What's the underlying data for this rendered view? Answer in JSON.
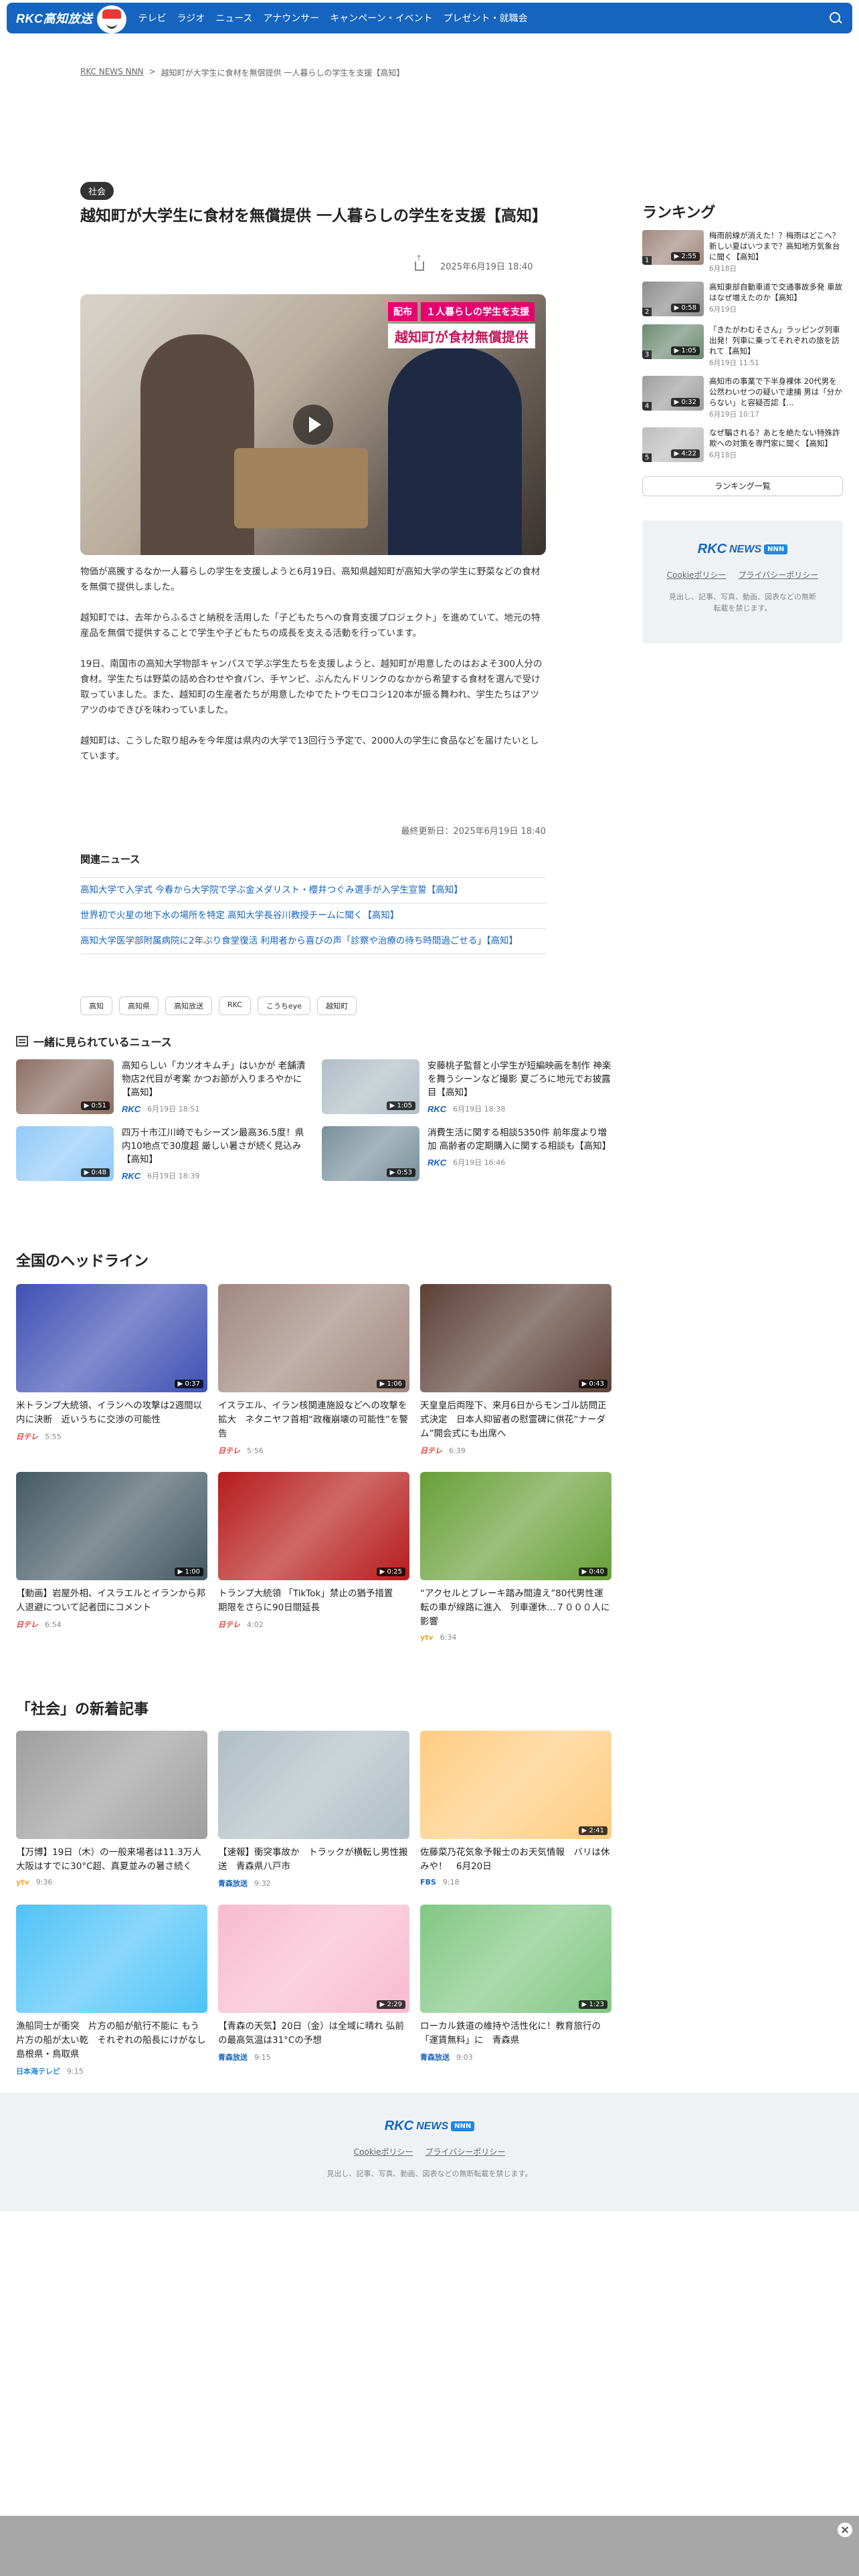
{
  "header": {
    "logo": "RKC高知放送",
    "nav": [
      "テレビ",
      "ラジオ",
      "ニュース",
      "アナウンサー",
      "キャンペーン・イベント",
      "プレゼント・就職会"
    ]
  },
  "breadcrumb": {
    "home": "RKC NEWS NNN",
    "separator": ">",
    "current": "越知町が大学生に食材を無償提供 一人暮らしの学生を支援【高知】"
  },
  "article": {
    "category": "社会",
    "title": "越知町が大学生に食材を無償提供 一人暮らしの学生を支援【高知】",
    "date": "2025年6月19日 18:40",
    "caption_tag": "配布",
    "caption_line1": "１人暮らしの学生を支援",
    "caption_line2": "越知町が食材無償提供",
    "paragraphs": [
      "物価が高騰するなか一人暮らしの学生を支援しようと6月19日、高知県越知町が高知大学の学生に野菜などの食材を無償で提供しました。",
      "越知町では、去年からふるさと納税を活用した「子どもたちへの食育支援プロジェクト」を進めていて、地元の特産品を無償で提供することで学生や子どもたちの成長を支える活動を行っています。",
      "19日、南国市の高知大学物部キャンパスで学ぶ学生たちを支援しようと、越知町が用意したのはおよそ300人分の食材。学生たちは野菜の詰め合わせや食パン、手ヤンピ、ぶんたんドリンクのなかから希望する食材を選んで受け取っていました。また、越知町の生産者たちが用意したゆでたトウモロコシ120本が振る舞われ、学生たちはアツアツのゆできびを味わっていました。",
      "越知町は、こうした取り組みを今年度は県内の大学で13回行う予定で、2000人の学生に食品などを届けたいとしています。"
    ],
    "updated": "最終更新日：2025年6月19日 18:40"
  },
  "related": {
    "heading": "関連ニュース",
    "items": [
      "高知大学で入学式 今春から大学院で学ぶ金メダリスト・櫻井つぐみ選手が入学生宣誓【高知】",
      "世界初で火星の地下水の場所を特定 高知大学長谷川教授チームに聞く【高知】",
      "高知大学医学部附属病院に2年ぶり食堂復活 利用者から喜びの声「診察や治療の待ち時間過ごせる」【高知】"
    ]
  },
  "tags": [
    "高知",
    "高知県",
    "高知放送",
    "RKC",
    "こうちeye",
    "越知町"
  ],
  "also_read": {
    "heading": "一緒に見られているニュース",
    "items": [
      {
        "title": "高知らしい「カツオキムチ」はいかが 老舗漬物店2代目が考案 かつお節が入りまろやかに【高知】",
        "source": "RKC",
        "date": "6月19日 18:51",
        "duration": "0:51",
        "color": "#8d6e63"
      },
      {
        "title": "安藤桃子監督と小学生が短編映画を制作 神楽を舞うシーンなど撮影 夏ごろに地元でお披露目【高知】",
        "source": "RKC",
        "date": "6月19日 18:38",
        "duration": "1:05",
        "color": "#b0bec5"
      },
      {
        "title": "四万十市江川崎でもシーズン最高36.5度！県内10地点で30度超 厳しい暑さが続く見込み【高知】",
        "source": "RKC",
        "date": "6月19日 18:39",
        "duration": "0:48",
        "color": "#90caf9"
      },
      {
        "title": "消費生活に関する相談5350件 前年度より増加 高齢者の定期購入に関する相談も【高知】",
        "source": "RKC",
        "date": "6月19日 16:46",
        "duration": "0:53",
        "color": "#78909c"
      }
    ]
  },
  "ranking": {
    "heading": "ランキング",
    "more": "ランキング一覧",
    "items": [
      {
        "num": "1",
        "title": "梅雨前線が消えた！？梅雨はどこへ？新しい夏はいつまで？高知地方気象台に聞く【高知】",
        "date": "6月18日",
        "duration": "2:55",
        "color": "#a1887f"
      },
      {
        "title": "高知東部自動車道で交通事故多発 車故はなぜ増えたのか【高知】",
        "num": "2",
        "date": "6月19日",
        "duration": "0:58",
        "color": "#8d8d8d"
      },
      {
        "num": "3",
        "title": "「きたがわむそさん」ラッピング列車出発！列車に乗ってそれぞれの旅を訪れて【高知】",
        "date": "6月19日 11:51",
        "duration": "1:05",
        "color": "#6d8b74"
      },
      {
        "num": "4",
        "title": "高知市の事業で下半身裸体 20代男を公然わいせつの疑いで逮捕 男は「分からない」と容疑否認【…",
        "date": "6月19日 10:17",
        "duration": "0:32",
        "color": "#9e9e9e"
      },
      {
        "num": "5",
        "title": "なぜ騙される？あとを絶たない特殊詐欺への対策を専門家に聞く【高知】",
        "date": "6月18日",
        "duration": "4:22",
        "color": "#bdbdbd"
      }
    ]
  },
  "footer": {
    "brand_rkc": "RKC",
    "brand_news": "NEWS",
    "brand_nnn": "NNN",
    "cookie": "Cookieポリシー",
    "privacy": "プライバシーポリシー",
    "note": "見出し、記事、写真、動画、図表などの無断転載を禁じます。"
  },
  "national": {
    "heading": "全国のヘッドライン",
    "items": [
      {
        "title": "米トランプ大統領、イランへの攻撃は2週間以内に決断　近いうちに交渉の可能性",
        "source": "日テレ",
        "src_class": "ntv",
        "time": "5:55",
        "duration": "0:37",
        "color": "#3f51b5"
      },
      {
        "title": "イスラエル、イラン核関連施設などへの攻撃を拡大　ネタニヤフ首相“政権崩壊の可能性”を警告",
        "source": "日テレ",
        "src_class": "ntv",
        "time": "5:56",
        "duration": "1:06",
        "color": "#a1887f"
      },
      {
        "title": "天皇皇后両陛下、来月6日からモンゴル訪問正式決定　日本人抑留者の慰霊碑に供花“ナーダム”開会式にも出席へ",
        "source": "日テレ",
        "src_class": "ntv",
        "time": "6:39",
        "duration": "0:43",
        "color": "#5d4037"
      },
      {
        "title": "【動画】岩屋外相、イスラエルとイランから邦人退避について記者団にコメント",
        "source": "日テレ",
        "src_class": "ntv",
        "time": "6:54",
        "duration": "1:00",
        "color": "#455a64"
      },
      {
        "title": "トランプ大統領 「TikTok」禁止の猶予措置　期限をさらに90日間延長",
        "source": "日テレ",
        "src_class": "ntv",
        "time": "4:02",
        "duration": "0:25",
        "color": "#b71c1c"
      },
      {
        "title": "“アクセルとブレーキ踏み間違え”80代男性運転の車が線路に進入　列車運休…７０００人に影響",
        "source": "ytv",
        "src_class": "ytv",
        "time": "6:34",
        "duration": "0:40",
        "color": "#689f38"
      }
    ]
  },
  "society": {
    "heading": "「社会」の新着記事",
    "items": [
      {
        "title": "【万博】19日（木）の一般来場者は11.3万人　大阪はすでに30°C超、真夏並みの暑さ続く",
        "source": "ytv",
        "src_class": "ytv",
        "time": "9:36",
        "duration": "",
        "color": "#9e9e9e"
      },
      {
        "title": "【速報】衝突事故か　トラックが横転し男性搬送　青森県八戸市",
        "source": "青森放送",
        "src_class": "fbs",
        "time": "9:32",
        "duration": "",
        "color": "#b0bec5"
      },
      {
        "title": "佐藤菜乃花気象予報士のお天気情報　バリは休みや！　6月20日",
        "source": "FBS",
        "src_class": "fbs",
        "time": "9:18",
        "duration": "2:41",
        "color": "#ffcc80"
      },
      {
        "title": "漁船同士が衝突　片方の船が航行不能に もう片方の船が太い乾　それぞれの船長にけがなし　島根県・鳥取県",
        "source": "日本海テレビ",
        "src_class": "nnn-src",
        "time": "9:15",
        "duration": "",
        "color": "#4fc3f7"
      },
      {
        "title": "【青森の天気】20日（金）は全域に晴れ 弘前の最高気温は31°Cの予想",
        "source": "青森放送",
        "src_class": "fbs",
        "time": "9:15",
        "duration": "2:29",
        "color": "#f8bbd0"
      },
      {
        "title": "ローカル鉄道の維持や活性化に！教育旅行の「運賃無料」に　青森県",
        "source": "青森放送",
        "src_class": "fbs",
        "time": "9:03",
        "duration": "1:23",
        "color": "#81c784"
      }
    ]
  }
}
